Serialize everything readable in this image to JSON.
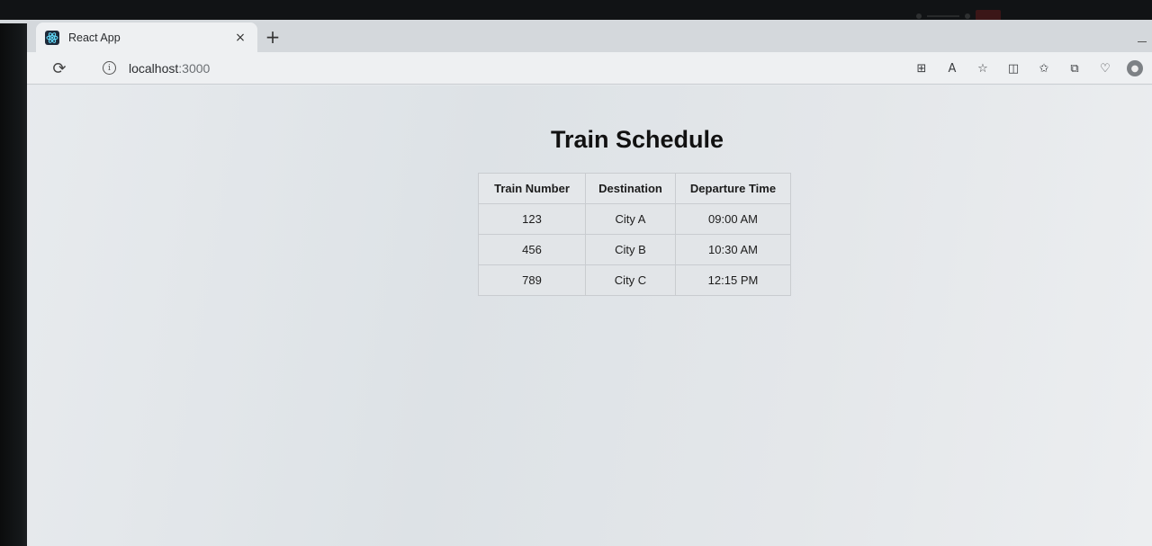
{
  "browser": {
    "tab": {
      "title": "React App",
      "close": "×"
    },
    "new_tab": "+",
    "url": {
      "host": "localhost",
      "port": ":3000"
    },
    "nav": {
      "back": "←",
      "reload": "⟳"
    },
    "info": "i",
    "icons": [
      "apps-icon",
      "read-aloud-icon",
      "favorite-star-icon",
      "split-screen-icon",
      "favorites-icon",
      "collections-icon",
      "extensions-icon",
      "profile-avatar-icon"
    ]
  },
  "page": {
    "title": "Train Schedule",
    "table": {
      "headers": [
        "Train Number",
        "Destination",
        "Departure Time"
      ],
      "rows": [
        [
          "123",
          "City A",
          "09:00 AM"
        ],
        [
          "456",
          "City B",
          "10:30 AM"
        ],
        [
          "789",
          "City C",
          "12:15 PM"
        ]
      ]
    }
  }
}
